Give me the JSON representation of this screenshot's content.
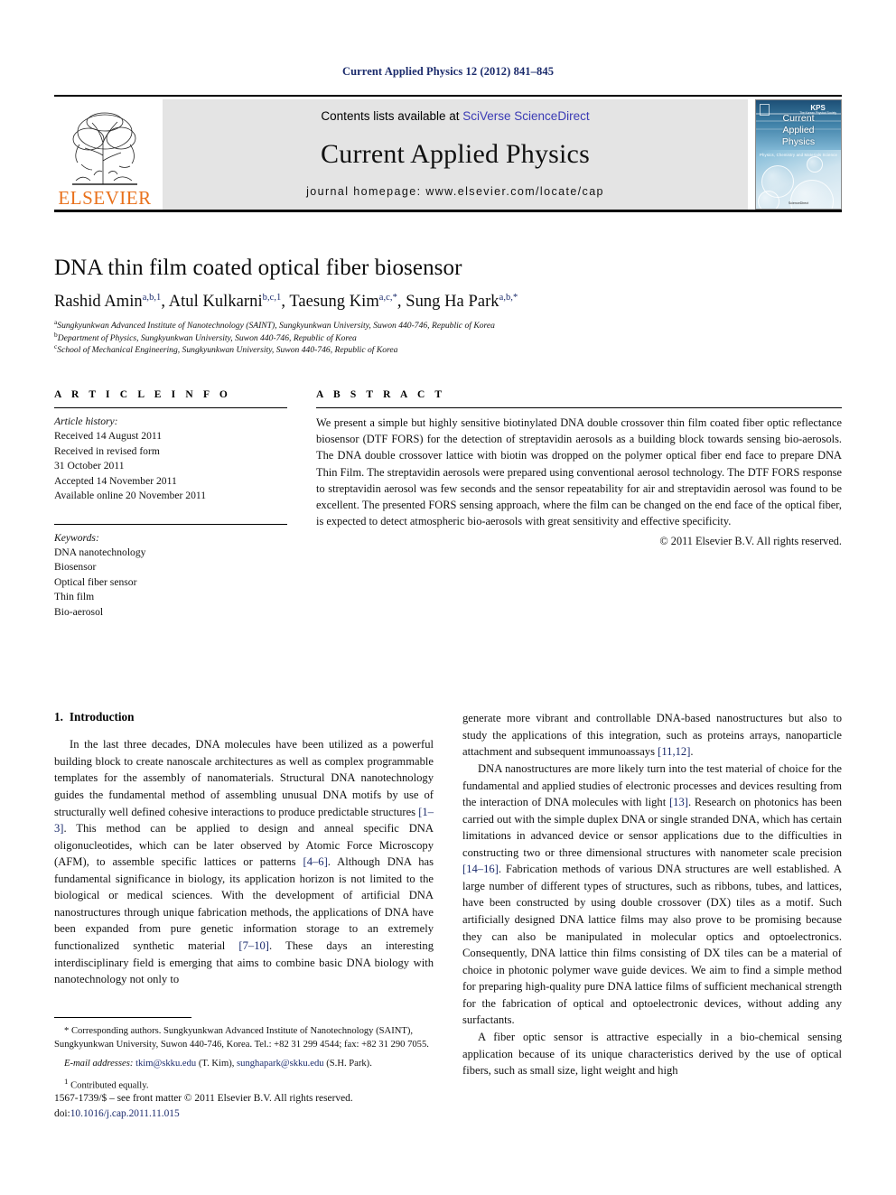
{
  "running_head": "Current Applied Physics 12 (2012) 841–845",
  "masthead": {
    "publisher_name": "ELSEVIER",
    "contents_prefix": "Contents lists available at ",
    "contents_link": "SciVerse ScienceDirect",
    "journal_title": "Current Applied Physics",
    "homepage": "journal homepage: www.elsevier.com/locate/cap",
    "cover": {
      "line1": "Current",
      "line2": "Applied",
      "line3": "Physics",
      "subtitle": "Physics, Chemistry and Materials Science",
      "society": "KPS",
      "society_sub": "The Korean Physical Society",
      "footer": "ScienceDirect"
    }
  },
  "article": {
    "title": "DNA thin film coated optical fiber biosensor",
    "authors": [
      {
        "name": "Rashid Amin",
        "sup": "a,b,1",
        "sep": ", "
      },
      {
        "name": "Atul Kulkarni",
        "sup": "b,c,1",
        "sep": ", "
      },
      {
        "name": "Taesung Kim",
        "sup": "a,c,*",
        "sep": ", "
      },
      {
        "name": "Sung Ha Park",
        "sup": "a,b,*",
        "sep": ""
      }
    ],
    "affiliations": [
      {
        "mark": "a",
        "text": "Sungkyunkwan Advanced Institute of Nanotechnology (SAINT), Sungkyunkwan University, Suwon 440-746, Republic of Korea"
      },
      {
        "mark": "b",
        "text": "Department of Physics, Sungkyunkwan University, Suwon 440-746, Republic of Korea"
      },
      {
        "mark": "c",
        "text": "School of Mechanical Engineering, Sungkyunkwan University, Suwon 440-746, Republic of Korea"
      }
    ]
  },
  "article_info": {
    "heading": "A R T I C L E   I N F O",
    "history_label": "Article history:",
    "history": [
      "Received 14 August 2011",
      "Received in revised form",
      "31 October 2011",
      "Accepted 14 November 2011",
      "Available online 20 November 2011"
    ],
    "keywords_label": "Keywords:",
    "keywords": [
      "DNA nanotechnology",
      "Biosensor",
      "Optical fiber sensor",
      "Thin film",
      "Bio-aerosol"
    ]
  },
  "abstract": {
    "heading": "A B S T R A C T",
    "text": "We present a simple but highly sensitive biotinylated DNA double crossover thin film coated fiber optic reflectance biosensor (DTF FORS) for the detection of streptavidin aerosols as a building block towards sensing bio-aerosols. The DNA double crossover lattice with biotin was dropped on the polymer optical fiber end face to prepare DNA Thin Film. The streptavidin aerosols were prepared using conventional aerosol technology. The DTF FORS response to streptavidin aerosol was few seconds and the sensor repeatability for air and streptavidin aerosol was found to be excellent. The presented FORS sensing approach, where the film can be changed on the end face of the optical fiber, is expected to detect atmospheric bio-aerosols with great sensitivity and effective specificity.",
    "copyright": "© 2011 Elsevier B.V. All rights reserved."
  },
  "section": {
    "number": "1.",
    "title": "Introduction"
  },
  "body": {
    "left_p1_a": "In the last three decades, DNA molecules have been utilized as a powerful building block to create nanoscale architectures as well as complex programmable templates for the assembly of nanomaterials. Structural DNA nanotechnology guides the fundamental method of assembling unusual DNA motifs by use of structurally well defined cohesive interactions to produce predictable structures ",
    "ref_1_3": "[1–3]",
    "left_p1_b": ". This method can be applied to design and anneal specific DNA oligonucleotides, which can be later observed by Atomic Force Microscopy (AFM), to assemble specific lattices or patterns ",
    "ref_4_6": "[4–6]",
    "left_p1_c": ". Although DNA has fundamental significance in biology, its application horizon is not limited to the biological or medical sciences. With the development of artificial DNA nanostructures through unique fabrication methods, the applications of DNA have been expanded from pure genetic information storage to an extremely functionalized synthetic material ",
    "ref_7_10": "[7–10]",
    "left_p1_d": ". These days an interesting interdisciplinary field is emerging that aims to combine basic DNA biology with nanotechnology not only to",
    "right_p1_a": "generate more vibrant and controllable DNA-based nanostructures but also to study the applications of this integration, such as proteins arrays, nanoparticle attachment and subsequent immunoassays ",
    "ref_11_12": "[11,12]",
    "right_p1_b": ".",
    "right_p2_a": "DNA nanostructures are more likely turn into the test material of choice for the fundamental and applied studies of electronic processes and devices resulting from the interaction of DNA molecules with light ",
    "ref_13": "[13]",
    "right_p2_b": ". Research on photonics has been carried out with the simple duplex DNA or single stranded DNA, which has certain limitations in advanced device or sensor applications due to the difficulties in constructing two or three dimensional structures with nanometer scale precision ",
    "ref_14_16": "[14–16]",
    "right_p2_c": ". Fabrication methods of various DNA structures are well established. A large number of different types of structures, such as ribbons, tubes, and lattices, have been constructed by using double crossover (DX) tiles as a motif. Such artificially designed DNA lattice films may also prove to be promising because they can also be manipulated in molecular optics and optoelectronics. Consequently, DNA lattice thin films consisting of DX tiles can be a material of choice in photonic polymer wave guide devices. We aim to find a simple method for preparing high-quality pure DNA lattice films of sufficient mechanical strength for the fabrication of optical and optoelectronic devices, without adding any surfactants.",
    "right_p3": "A fiber optic sensor is attractive especially in a bio-chemical sensing application because of its unique characteristics derived by the use of optical fibers, such as small size, light weight and high"
  },
  "footnotes": {
    "corresponding": "* Corresponding authors. Sungkyunkwan Advanced Institute of Nanotechnology (SAINT), Sungkyunkwan University, Suwon 440-746, Korea. Tel.: +82 31 299 4544; fax: +82 31 290 7055.",
    "email_label": "E-mail addresses:",
    "email1": "tkim@skku.edu",
    "email1_owner": "(T. Kim)",
    "email2": "sunghapark@skku.edu",
    "email2_owner": "(S.H. Park).",
    "contributed_mark": "1",
    "contributed": "Contributed equally."
  },
  "issn": {
    "line1": "1567-1739/$ – see front matter © 2011 Elsevier B.V. All rights reserved.",
    "doi_label": "doi:",
    "doi_value": "10.1016/j.cap.2011.11.015"
  }
}
